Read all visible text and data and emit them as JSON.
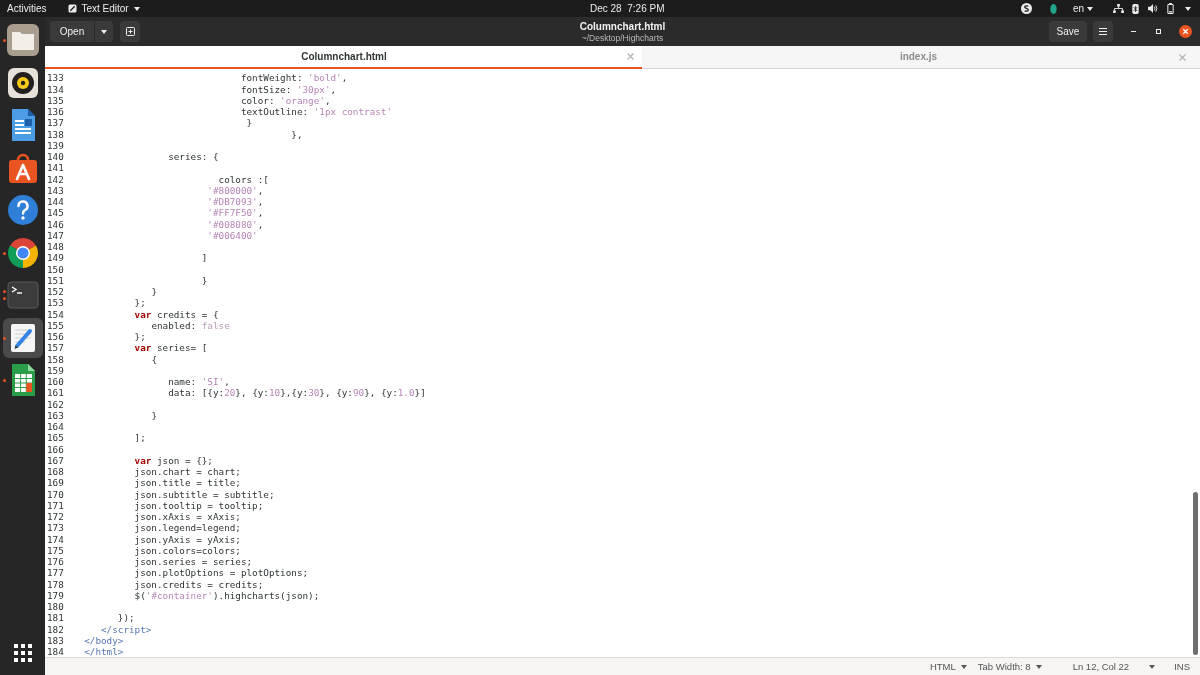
{
  "top_bar": {
    "activities": "Activities",
    "app_menu": "Text Editor",
    "clock": "Dec 28  7:26 PM",
    "keyboard_layout": "en"
  },
  "dock": [
    {
      "kind": "files",
      "running": true,
      "multiple_windows": false,
      "selected": false
    },
    {
      "kind": "music",
      "running": false,
      "multiple_windows": false,
      "selected": false
    },
    {
      "kind": "writer",
      "running": false,
      "multiple_windows": false,
      "selected": false
    },
    {
      "kind": "software",
      "running": false,
      "multiple_windows": false,
      "selected": false
    },
    {
      "kind": "help",
      "running": false,
      "multiple_windows": false,
      "selected": false
    },
    {
      "kind": "browser",
      "running": true,
      "multiple_windows": false,
      "selected": false
    },
    {
      "kind": "terminal",
      "running": true,
      "multiple_windows": true,
      "selected": false
    },
    {
      "kind": "text_editor",
      "running": true,
      "multiple_windows": false,
      "selected": true
    },
    {
      "kind": "spreadsheet",
      "running": true,
      "multiple_windows": false,
      "selected": false
    }
  ],
  "header_bar": {
    "open_button": "Open",
    "title": "Columnchart.html",
    "subtitle": "~/Desktop/Highcharts",
    "save_button": "Save"
  },
  "tabs": [
    {
      "label": "Columnchart.html",
      "selected": true
    },
    {
      "label": "index.js",
      "selected": false
    }
  ],
  "editor": {
    "lines": [
      {
        "number": "133",
        "code": [
          {
            "kind": "plain",
            "text": "                              fontWeight: "
          },
          {
            "kind": "string",
            "text": "'bold'"
          },
          {
            "kind": "plain",
            "text": ","
          }
        ]
      },
      {
        "number": "134",
        "code": [
          {
            "kind": "plain",
            "text": "                              fontSize: "
          },
          {
            "kind": "string",
            "text": "'30px'"
          },
          {
            "kind": "plain",
            "text": ","
          }
        ]
      },
      {
        "number": "135",
        "code": [
          {
            "kind": "plain",
            "text": "                              color: "
          },
          {
            "kind": "string",
            "text": "'orange'"
          },
          {
            "kind": "plain",
            "text": ","
          }
        ]
      },
      {
        "number": "136",
        "code": [
          {
            "kind": "plain",
            "text": "                              textOutline: "
          },
          {
            "kind": "string",
            "text": "'1px contrast'"
          }
        ]
      },
      {
        "number": "137",
        "code": [
          {
            "kind": "plain",
            "text": "                               }"
          }
        ]
      },
      {
        "number": "138",
        "code": [
          {
            "kind": "plain",
            "text": "                                       },"
          }
        ]
      },
      {
        "number": "139"
      },
      {
        "number": "140",
        "code": [
          {
            "kind": "plain",
            "text": "                 series: {"
          }
        ]
      },
      {
        "number": "141"
      },
      {
        "number": "142",
        "code": [
          {
            "kind": "plain",
            "text": "                          colors :["
          }
        ]
      },
      {
        "number": "143",
        "code": [
          {
            "kind": "string",
            "text": "                        '#800000'"
          },
          {
            "kind": "plain",
            "text": ","
          }
        ]
      },
      {
        "number": "144",
        "code": [
          {
            "kind": "string",
            "text": "                        '#DB7093'"
          },
          {
            "kind": "plain",
            "text": ","
          }
        ]
      },
      {
        "number": "145",
        "code": [
          {
            "kind": "string",
            "text": "                        '#FF7F50'"
          },
          {
            "kind": "plain",
            "text": ","
          }
        ]
      },
      {
        "number": "146",
        "code": [
          {
            "kind": "string",
            "text": "                        '#008080'"
          },
          {
            "kind": "plain",
            "text": ","
          }
        ]
      },
      {
        "number": "147",
        "code": [
          {
            "kind": "string",
            "text": "                        '#006400'"
          }
        ]
      },
      {
        "number": "148"
      },
      {
        "number": "149",
        "code": [
          {
            "kind": "plain",
            "text": "                       ]"
          }
        ]
      },
      {
        "number": "150"
      },
      {
        "number": "151",
        "code": [
          {
            "kind": "plain",
            "text": "                       }"
          }
        ]
      },
      {
        "number": "152",
        "code": [
          {
            "kind": "plain",
            "text": "              }"
          }
        ]
      },
      {
        "number": "153",
        "code": [
          {
            "kind": "plain",
            "text": "           };"
          }
        ]
      },
      {
        "number": "154",
        "code": [
          {
            "kind": "keyword",
            "text": "           var"
          },
          {
            "kind": "plain",
            "text": " credits = {"
          }
        ]
      },
      {
        "number": "155",
        "code": [
          {
            "kind": "plain",
            "text": "              enabled: "
          },
          {
            "kind": "boolean",
            "text": "false"
          }
        ]
      },
      {
        "number": "156",
        "code": [
          {
            "kind": "plain",
            "text": "           };"
          }
        ]
      },
      {
        "number": "157",
        "code": [
          {
            "kind": "keyword",
            "text": "           var"
          },
          {
            "kind": "plain",
            "text": " series= ["
          }
        ]
      },
      {
        "number": "158",
        "code": [
          {
            "kind": "plain",
            "text": "              {"
          }
        ]
      },
      {
        "number": "159"
      },
      {
        "number": "160",
        "code": [
          {
            "kind": "plain",
            "text": "                 name: "
          },
          {
            "kind": "string",
            "text": "'SI'"
          },
          {
            "kind": "plain",
            "text": ","
          }
        ]
      },
      {
        "number": "161",
        "code": [
          {
            "kind": "plain",
            "text": "                 data: [{y:"
          },
          {
            "kind": "number",
            "text": "20"
          },
          {
            "kind": "plain",
            "text": "}, {y:"
          },
          {
            "kind": "number",
            "text": "10"
          },
          {
            "kind": "plain",
            "text": "},{y:"
          },
          {
            "kind": "number",
            "text": "30"
          },
          {
            "kind": "plain",
            "text": "}, {y:"
          },
          {
            "kind": "number",
            "text": "90"
          },
          {
            "kind": "plain",
            "text": "}, {y:"
          },
          {
            "kind": "number",
            "text": "1.0"
          },
          {
            "kind": "plain",
            "text": "}]"
          }
        ]
      },
      {
        "number": "162"
      },
      {
        "number": "163",
        "code": [
          {
            "kind": "plain",
            "text": "              }"
          }
        ]
      },
      {
        "number": "164"
      },
      {
        "number": "165",
        "code": [
          {
            "kind": "plain",
            "text": "           ];"
          }
        ]
      },
      {
        "number": "166"
      },
      {
        "number": "167",
        "code": [
          {
            "kind": "keyword",
            "text": "           var"
          },
          {
            "kind": "plain",
            "text": " json = {};"
          }
        ]
      },
      {
        "number": "168",
        "code": [
          {
            "kind": "plain",
            "text": "           json.chart = chart;"
          }
        ]
      },
      {
        "number": "169",
        "code": [
          {
            "kind": "plain",
            "text": "           json.title = title;"
          }
        ]
      },
      {
        "number": "170",
        "code": [
          {
            "kind": "plain",
            "text": "           json.subtitle = subtitle;"
          }
        ]
      },
      {
        "number": "171",
        "code": [
          {
            "kind": "plain",
            "text": "           json.tooltip = tooltip;"
          }
        ]
      },
      {
        "number": "172",
        "code": [
          {
            "kind": "plain",
            "text": "           json.xAxis = xAxis;"
          }
        ]
      },
      {
        "number": "173",
        "code": [
          {
            "kind": "plain",
            "text": "           json.legend=legend;"
          }
        ]
      },
      {
        "number": "174",
        "code": [
          {
            "kind": "plain",
            "text": "           json.yAxis = yAxis;"
          }
        ]
      },
      {
        "number": "175",
        "code": [
          {
            "kind": "plain",
            "text": "           json.colors=colors;"
          }
        ]
      },
      {
        "number": "176",
        "code": [
          {
            "kind": "plain",
            "text": "           json.series = series;"
          }
        ]
      },
      {
        "number": "177",
        "code": [
          {
            "kind": "plain",
            "text": "           json.plotOptions = plotOptions;"
          }
        ]
      },
      {
        "number": "178",
        "code": [
          {
            "kind": "plain",
            "text": "           json.credits = credits;"
          }
        ]
      },
      {
        "number": "179",
        "code": [
          {
            "kind": "plain",
            "text": "           $("
          },
          {
            "kind": "string",
            "text": "'#container'"
          },
          {
            "kind": "plain",
            "text": ").highcharts(json);"
          }
        ]
      },
      {
        "number": "180"
      },
      {
        "number": "181",
        "code": [
          {
            "kind": "plain",
            "text": "        });"
          }
        ]
      },
      {
        "number": "182",
        "code": [
          {
            "kind": "tag",
            "text": "     </script>"
          }
        ]
      },
      {
        "number": "183",
        "code": [
          {
            "kind": "tag",
            "text": "  </body>"
          }
        ]
      },
      {
        "number": "184",
        "code": [
          {
            "kind": "tag",
            "text": "  </html>"
          }
        ]
      }
    ]
  },
  "status_bar": {
    "language": "HTML",
    "tab_width": "Tab Width: 8",
    "cursor_position": "Ln 12, Col 22",
    "insert_mode": "INS"
  }
}
